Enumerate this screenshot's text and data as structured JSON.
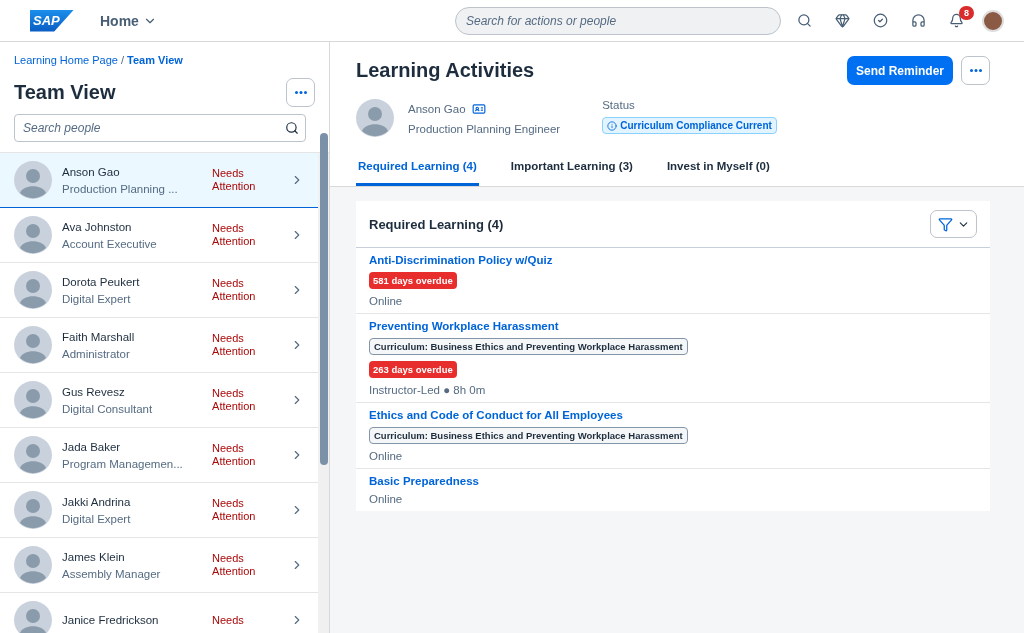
{
  "shell": {
    "logo": "SAP",
    "home_menu": "Home",
    "search_placeholder": "Search for actions or people",
    "notification_count": "8"
  },
  "breadcrumb": {
    "separator": "/",
    "items": [
      {
        "label": "Learning Home Page",
        "current": false
      },
      {
        "label": "Team View",
        "current": true
      }
    ]
  },
  "team": {
    "title": "Team View",
    "search_placeholder": "Search people",
    "members": [
      {
        "name": "Anson Gao",
        "role": "Production Planning ...",
        "status": "Needs Attention",
        "selected": true
      },
      {
        "name": "Ava Johnston",
        "role": "Account Executive",
        "status": "Needs Attention",
        "selected": false
      },
      {
        "name": "Dorota Peukert",
        "role": "Digital Expert",
        "status": "Needs Attention",
        "selected": false
      },
      {
        "name": "Faith Marshall",
        "role": "Administrator",
        "status": "Needs Attention",
        "selected": false
      },
      {
        "name": "Gus Revesz",
        "role": "Digital Consultant",
        "status": "Needs Attention",
        "selected": false
      },
      {
        "name": "Jada Baker",
        "role": "Program Managemen...",
        "status": "Needs Attention",
        "selected": false
      },
      {
        "name": "Jakki Andrina",
        "role": "Digital Expert",
        "status": "Needs Attention",
        "selected": false
      },
      {
        "name": "James Klein",
        "role": "Assembly Manager",
        "status": "Needs Attention",
        "selected": false
      },
      {
        "name": "Janice Fredrickson",
        "status": "Needs",
        "selected": false
      }
    ]
  },
  "activities": {
    "title": "Learning Activities",
    "primary_action": "Send Reminder",
    "person": {
      "name": "Anson Gao",
      "role": "Production Planning Engineer"
    },
    "status_label": "Status",
    "status": "Curriculum Compliance Current",
    "tabs": [
      {
        "label": "Required Learning (4)",
        "selected": true
      },
      {
        "label": "Important Learning (3)",
        "selected": false
      },
      {
        "label": "Invest in Myself (0)",
        "selected": false
      }
    ],
    "section": {
      "title": "Required Learning (4)",
      "items": [
        {
          "title": "Anti-Discrimination Policy w/Quiz",
          "overdue": "581 days overdue",
          "meta": "Online"
        },
        {
          "title": "Preventing Workplace Harassment",
          "curriculum": "Curriculum: Business Ethics and Preventing Workplace Harassment",
          "overdue": "263 days overdue",
          "meta": "Instructor-Led ● 8h 0m"
        },
        {
          "title": "Ethics and Code of Conduct for All Employees",
          "curriculum": "Curriculum: Business Ethics and Preventing Workplace Harassment",
          "meta": "Online"
        },
        {
          "title": "Basic Preparedness",
          "meta": "Online"
        }
      ]
    }
  }
}
